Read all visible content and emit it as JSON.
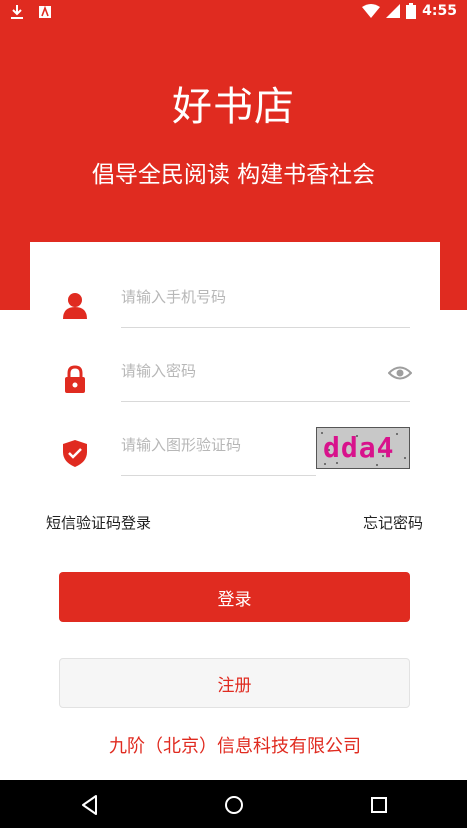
{
  "status_bar": {
    "time": "4:55"
  },
  "header": {
    "title": "好书店",
    "slogan": "倡导全民阅读 构建书香社会"
  },
  "form": {
    "phone_placeholder": "请输入手机号码",
    "password_placeholder": "请输入密码",
    "captcha_placeholder": "请输入图形验证码",
    "captcha_code": "dda4",
    "sms_login_label": "短信验证码登录",
    "forgot_password_label": "忘记密码",
    "login_label": "登录",
    "register_label": "注册"
  },
  "footer": {
    "company": "九阶（北京）信息科技有限公司"
  },
  "colors": {
    "brand_red": "#e02b20",
    "captcha_text": "#d8128c"
  },
  "icons": [
    "download-icon",
    "app-notification-icon",
    "wifi-icon",
    "signal-icon",
    "battery-icon",
    "user-icon",
    "lock-icon",
    "shield-icon",
    "eye-icon",
    "back-icon",
    "home-icon",
    "recents-icon"
  ]
}
